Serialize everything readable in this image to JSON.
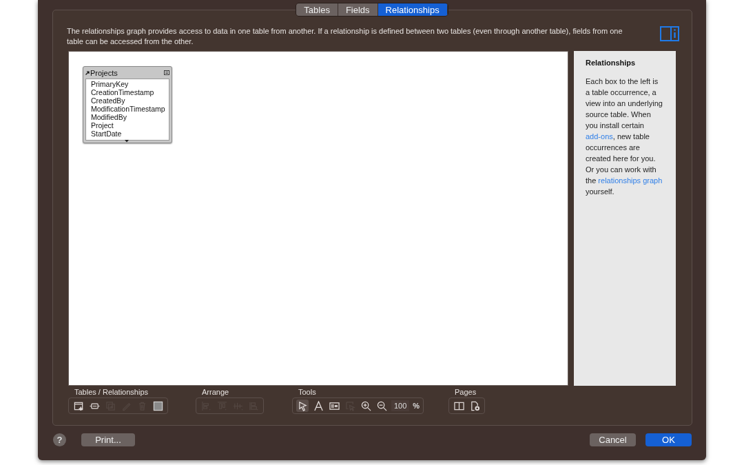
{
  "tabs": [
    {
      "label": "Tables",
      "selected": false
    },
    {
      "label": "Fields",
      "selected": false
    },
    {
      "label": "Relationships",
      "selected": true
    }
  ],
  "description": "The relationships graph provides access to data in one table from another. If a relationship is defined between two tables (even through another table), fields from one table can be accessed from the other.",
  "graph": {
    "tables": [
      {
        "name": "Projects",
        "fields": [
          "PrimaryKey",
          "CreationTimestamp",
          "CreatedBy",
          "ModificationTimestamp",
          "ModifiedBy",
          "Project",
          "StartDate"
        ]
      }
    ]
  },
  "sidebar": {
    "title": "Relationships",
    "body": [
      {
        "kind": "text",
        "text": "Each box to the left is a table occurrence, a view into an underlying source table. When you install certain "
      },
      {
        "kind": "link",
        "text": "add-ons"
      },
      {
        "kind": "text",
        "text": ", new table occurrences are created here for you. Or you can work with the "
      },
      {
        "kind": "link",
        "text": "relationships graph"
      },
      {
        "kind": "text",
        "text": " yourself."
      }
    ]
  },
  "toolbar": [
    {
      "label": "Tables / Relationships",
      "items": [
        {
          "kind": "tool",
          "disabled": false
        },
        {
          "kind": "tool",
          "disabled": false
        },
        {
          "kind": "tool",
          "disabled": true
        },
        {
          "kind": "tool",
          "disabled": true
        },
        {
          "kind": "tool",
          "disabled": true
        },
        {
          "kind": "swatch",
          "disabled": false
        }
      ]
    },
    {
      "label": "Arrange",
      "items": [
        {
          "kind": "tool",
          "disabled": true
        },
        {
          "kind": "tool",
          "disabled": true
        },
        {
          "kind": "tool",
          "disabled": true
        },
        {
          "kind": "tool",
          "disabled": true
        }
      ]
    },
    {
      "label": "Tools",
      "items": [
        {
          "kind": "tool",
          "disabled": false,
          "selected": true
        },
        {
          "kind": "tool",
          "disabled": false,
          "selected": false
        },
        {
          "kind": "tool",
          "disabled": false,
          "selected": false
        },
        {
          "kind": "tool",
          "disabled": true,
          "selected": false
        },
        {
          "kind": "tool",
          "disabled": false
        },
        {
          "kind": "tool",
          "disabled": false
        },
        {
          "kind": "zoom",
          "value": "100"
        },
        {
          "kind": "unit",
          "text": "%"
        }
      ]
    },
    {
      "label": "Pages",
      "items": [
        {
          "kind": "tool",
          "disabled": false
        },
        {
          "kind": "tool",
          "disabled": false
        }
      ]
    }
  ],
  "footer": {
    "help": "?",
    "buttons": [
      {
        "label": "Print...",
        "default": false
      },
      {
        "label": "Cancel",
        "default": false
      },
      {
        "label": "OK",
        "default": true
      }
    ]
  }
}
